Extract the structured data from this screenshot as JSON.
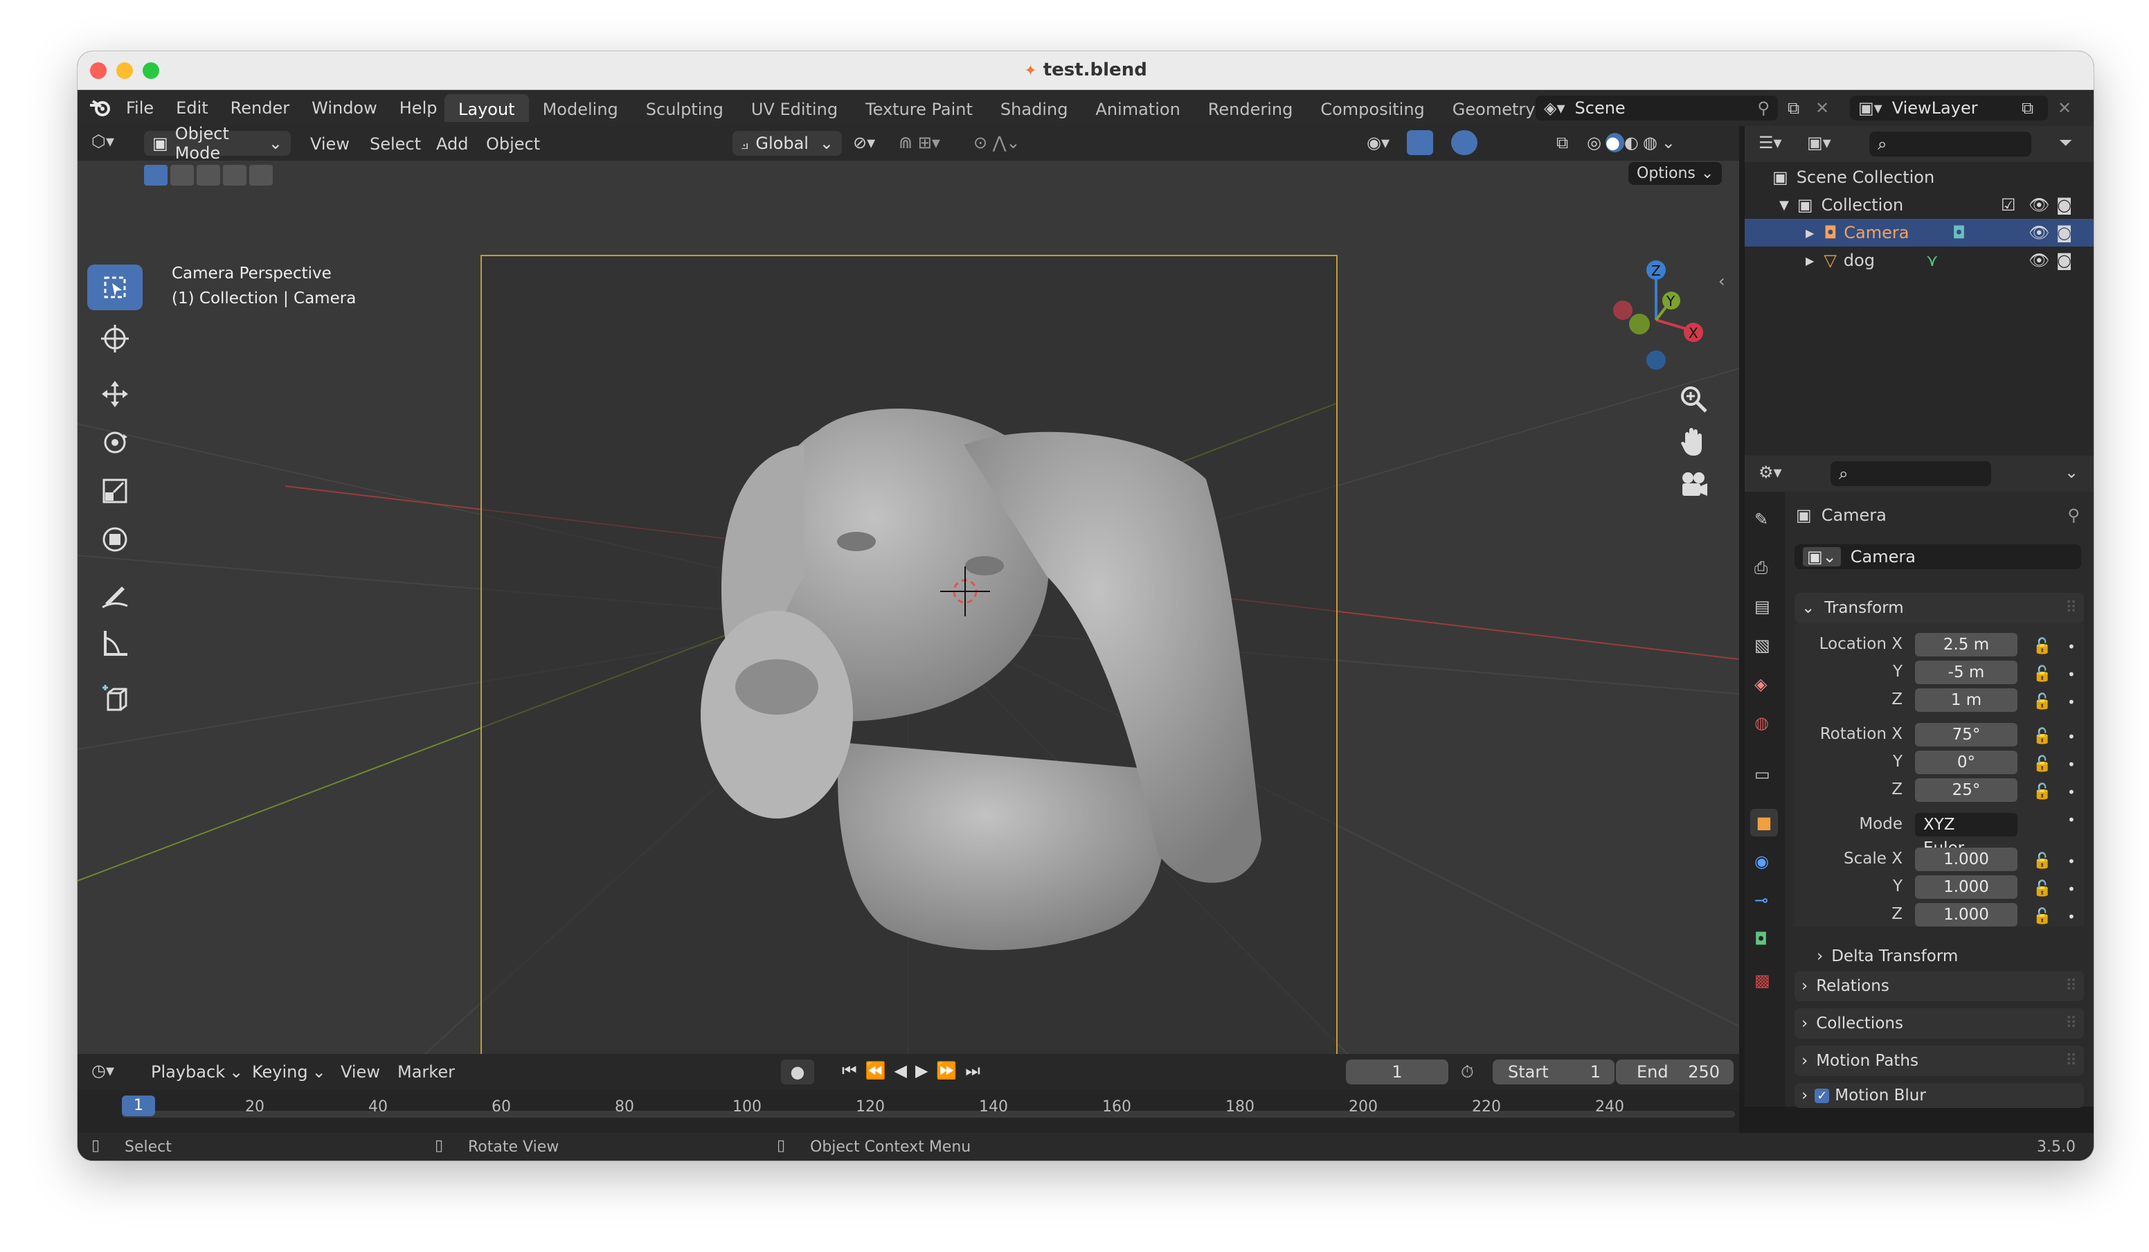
{
  "window": {
    "title": "test.blend"
  },
  "menu": [
    "File",
    "Edit",
    "Render",
    "Window",
    "Help"
  ],
  "workspaces": [
    "Layout",
    "Modeling",
    "Sculpting",
    "UV Editing",
    "Texture Paint",
    "Shading",
    "Animation",
    "Rendering",
    "Compositing",
    "Geometry Nodes"
  ],
  "active_workspace": "Layout",
  "scene": {
    "name": "Scene",
    "view_layer": "ViewLayer"
  },
  "viewport_header": {
    "mode": "Object Mode",
    "menus": [
      "View",
      "Select",
      "Add",
      "Object"
    ],
    "orientation": "Global",
    "options": "Options"
  },
  "viewport": {
    "title": "Camera Perspective",
    "subtitle": "(1) Collection | Camera"
  },
  "tools": [
    "select-box-icon",
    "cursor-icon",
    "move-icon",
    "rotate-icon",
    "scale-icon",
    "transform-icon",
    "annotate-icon",
    "measure-icon",
    "add-cube-icon"
  ],
  "outliner": {
    "root": "Scene Collection",
    "collection": "Collection",
    "items": [
      {
        "name": "Camera",
        "selected": true
      },
      {
        "name": "dog",
        "selected": false
      }
    ]
  },
  "properties": {
    "object_name": "Camera",
    "data_name": "Camera",
    "transform_label": "Transform",
    "location_label": "Location X",
    "rotation_label": "Rotation X",
    "scale_label": "Scale X",
    "y_label": "Y",
    "z_label": "Z",
    "location": [
      "2.5 m",
      "-5 m",
      "1 m"
    ],
    "rotation": [
      "75°",
      "0°",
      "25°"
    ],
    "mode_label": "Mode",
    "mode_value": "XYZ Euler",
    "scale": [
      "1.000",
      "1.000",
      "1.000"
    ],
    "subpanels": [
      "Delta Transform",
      "Relations",
      "Collections",
      "Motion Paths",
      "Motion Blur"
    ]
  },
  "timeline": {
    "menus": [
      "Playback",
      "Keying",
      "View",
      "Marker"
    ],
    "current_frame": "1",
    "start_label": "Start",
    "start": "1",
    "end_label": "End",
    "end": "250",
    "ticks": [
      "1",
      "20",
      "40",
      "60",
      "80",
      "100",
      "120",
      "140",
      "160",
      "180",
      "200",
      "220",
      "240"
    ]
  },
  "status": {
    "select": "Select",
    "rotate": "Rotate View",
    "context": "Object Context Menu",
    "version": "3.5.0"
  },
  "colors": {
    "accent": "#4772b3",
    "camera_frame": "#c49b36",
    "selected_object": "#f5a25c"
  }
}
